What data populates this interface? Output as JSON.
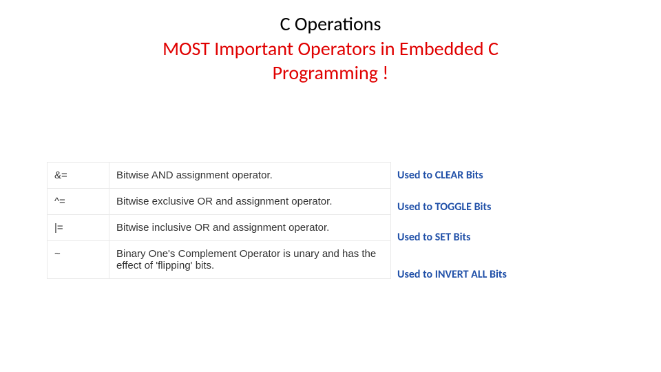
{
  "titles": {
    "main": "C Operations",
    "sub_line1": "MOST Important Operators in Embedded C",
    "sub_line2": "Programming !"
  },
  "rows": [
    {
      "op": "&=",
      "desc": "Bitwise AND assignment operator.",
      "usage": "Used to CLEAR Bits"
    },
    {
      "op": "^=",
      "desc": "Bitwise exclusive OR and assignment operator.",
      "usage": "Used to TOGGLE Bits"
    },
    {
      "op": "|=",
      "desc": "Bitwise inclusive OR and assignment operator.",
      "usage": "Used to SET Bits"
    },
    {
      "op": "~",
      "desc": "Binary One's Complement Operator is unary and has the effect of 'flipping' bits.",
      "usage": "Used to INVERT ALL Bits"
    }
  ]
}
